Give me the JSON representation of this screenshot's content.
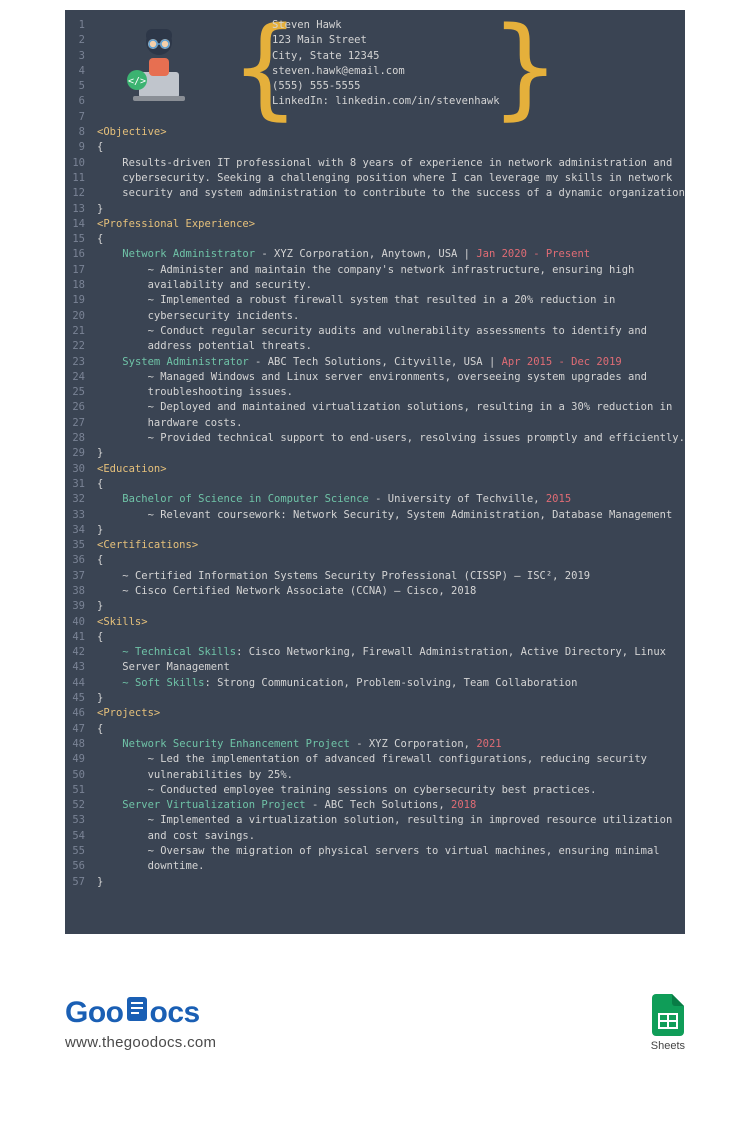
{
  "contact": {
    "name": "Steven Hawk",
    "address1": "123 Main Street",
    "address2": "City, State 12345",
    "email": "steven.hawk@email.com",
    "phone": "(555) 555-5555",
    "linkedin": "LinkedIn: linkedin.com/in/stevenhawk"
  },
  "sections": {
    "objective": {
      "tag": "<Objective>",
      "text1": "Results-driven IT professional with 8 years of experience in network administration and",
      "text2": "cybersecurity. Seeking a challenging position where I can leverage my skills in network",
      "text3": "security and system administration to contribute to the success of a dynamic organization."
    },
    "experience": {
      "tag": "<Professional Experience>",
      "job1": {
        "title": "Network Administrator",
        "company": " - XYZ Corporation, Anytown, USA | ",
        "date": "Jan 2020 - Present",
        "b1a": "~ Administer and maintain the company's network infrastructure, ensuring high",
        "b1b": "availability and security.",
        "b2a": "~ Implemented a robust firewall system that resulted in a 20% reduction in",
        "b2b": "cybersecurity incidents.",
        "b3a": "~ Conduct regular security audits and vulnerability assessments to identify and",
        "b3b": "address potential threats."
      },
      "job2": {
        "title": "System Administrator",
        "company": " - ABC Tech Solutions, Cityville, USA | ",
        "date": "Apr 2015 - Dec 2019",
        "b1a": "~ Managed Windows and Linux server environments, overseeing system upgrades and",
        "b1b": "troubleshooting issues.",
        "b2a": "~ Deployed and maintained virtualization solutions, resulting in a 30% reduction in",
        "b2b": "hardware costs.",
        "b3": "~ Provided technical support to end-users, resolving issues promptly and efficiently."
      }
    },
    "education": {
      "tag": "<Education>",
      "degree": "Bachelor of Science in Computer Science",
      "school": " - University of Techville, ",
      "year": "2015",
      "course": "~ Relevant coursework: Network Security, System Administration, Database Management"
    },
    "certs": {
      "tag": "<Certifications>",
      "c1": "~ Certified Information Systems Security Professional (CISSP) – ISC², 2019",
      "c2": "~ Cisco Certified Network Associate (CCNA) – Cisco, 2018"
    },
    "skills": {
      "tag": "<Skills>",
      "tech_label": "~ Technical Skills",
      "tech_text": ": Cisco Networking, Firewall Administration, Active Directory, Linux",
      "tech_text2": "Server Management",
      "soft_label": "~ Soft Skills",
      "soft_text": ": Strong Communication, Problem-solving, Team Collaboration"
    },
    "projects": {
      "tag": "<Projects>",
      "p1": {
        "title": "Network Security Enhancement Project",
        "company": " - XYZ Corporation, ",
        "year": "2021",
        "b1a": "~ Led the implementation of advanced firewall configurations, reducing security",
        "b1b": "vulnerabilities by 25%.",
        "b2": "~ Conducted employee training sessions on cybersecurity best practices."
      },
      "p2": {
        "title": "Server Virtualization Project",
        "company": " - ABC Tech Solutions, ",
        "year": "2018",
        "b1a": "~ Implemented a virtualization solution, resulting in improved resource utilization",
        "b1b": "and cost savings.",
        "b2a": "~ Oversaw the migration of physical servers to virtual machines, ensuring minimal",
        "b2b": "downtime."
      }
    }
  },
  "footer": {
    "logo_part1": "Goo",
    "logo_part2": "ocs",
    "url": "www.thegoodocs.com",
    "sheets": "Sheets"
  }
}
